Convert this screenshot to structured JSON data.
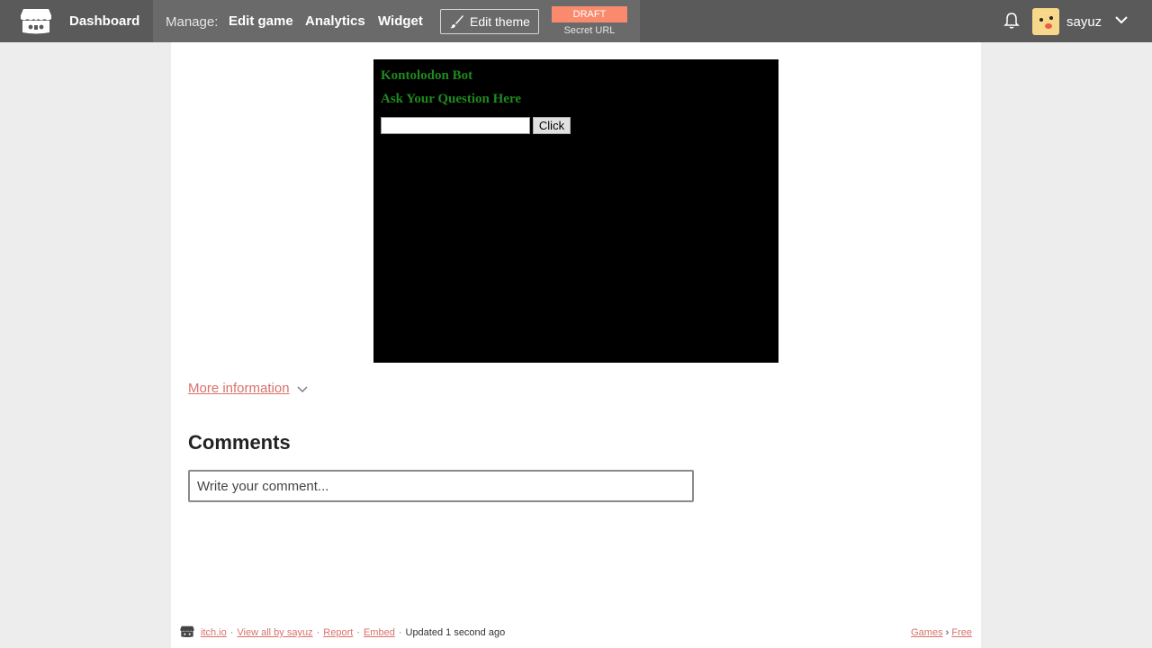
{
  "topbar": {
    "dashboard": "Dashboard",
    "manage_label": "Manage:",
    "edit_game": "Edit game",
    "analytics": "Analytics",
    "widget": "Widget",
    "edit_theme": "Edit theme",
    "draft_badge": "DRAFT",
    "secret_url": "Secret URL",
    "username": "sayuz"
  },
  "embed": {
    "title": "Kontolodon Bot",
    "prompt": "Ask Your Question Here",
    "input_value": "",
    "button_label": "Click"
  },
  "more_information": "More information",
  "comments": {
    "heading": "Comments",
    "placeholder": "Write your comment..."
  },
  "footer": {
    "site": "itch.io",
    "view_all": "View all by sayuz",
    "report": "Report",
    "embed": "Embed",
    "updated": "Updated 1 second ago",
    "games": "Games",
    "breadcrumb_sep": "›",
    "free": "Free",
    "dot": "·"
  },
  "colors": {
    "topbar_bg": "#5a5a5a",
    "manage_bg": "#6a6a6a",
    "draft_bg": "#fa8a6e",
    "link_color": "#d9716b",
    "bot_text": "#1f8a1f"
  }
}
